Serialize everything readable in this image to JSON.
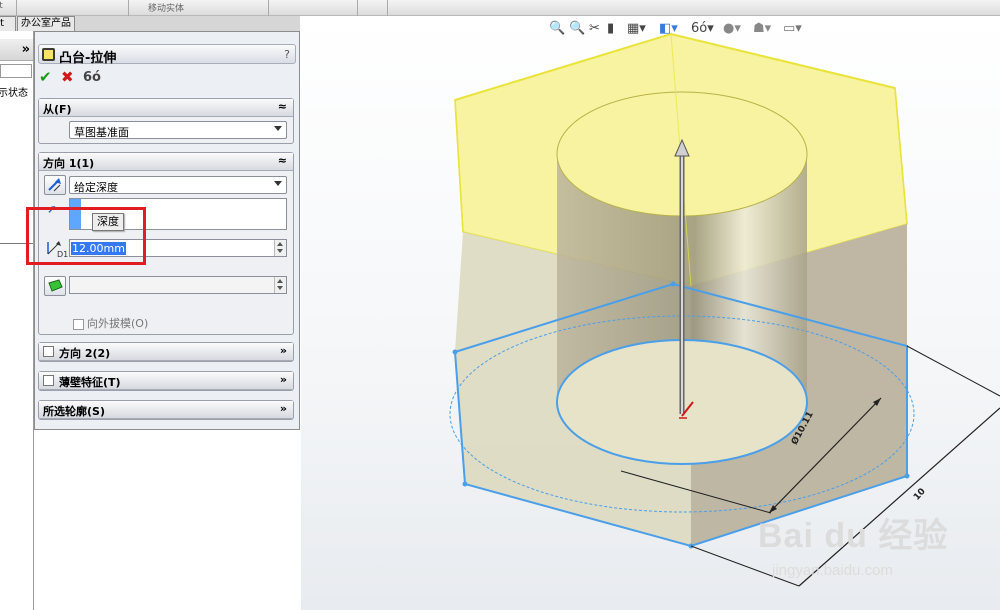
{
  "topbar": {
    "item_left": "ort",
    "item_mid": "移动实体"
  },
  "tabs": [
    {
      "label": "rt"
    },
    {
      "label": "办公室产品"
    }
  ],
  "left_panel": {
    "expand_chevron": "»",
    "display_state_label": "示状态"
  },
  "property_manager": {
    "title": "凸台-拉伸",
    "help": "?",
    "actions": {
      "ok_icon": "check-icon",
      "cancel_icon": "x-icon",
      "preview_icon": "glasses-icon"
    },
    "from_group": {
      "label": "从(F)",
      "collapse": "≈",
      "start_condition": "草图基准面"
    },
    "direction1_group": {
      "label": "方向 1(1)",
      "collapse": "≈",
      "end_condition": "给定深度",
      "tooltip": "深度",
      "depth_value": "12.00mm",
      "dim_label": "D1",
      "draft_outward_label": "向外拔模(O)"
    },
    "direction2_group": {
      "label": "方向 2(2)",
      "expand": "»"
    },
    "thin_feature_group": {
      "label": "薄壁特征(T)",
      "expand": "»"
    },
    "selected_contours_group": {
      "label": "所选轮廓(S)",
      "expand": "»"
    }
  },
  "viewport": {
    "dimension_circle": "Ø10.11",
    "dimension_edge": "10"
  },
  "watermark": {
    "brand": "Bai du 经验",
    "url": "jingyan.baidu.com"
  },
  "colors": {
    "accent_blue": "#5fa6ff",
    "highlight_red": "#e21c23",
    "body_yellow": "#f5ef8a",
    "sketch_blue": "#4a9fe8"
  }
}
